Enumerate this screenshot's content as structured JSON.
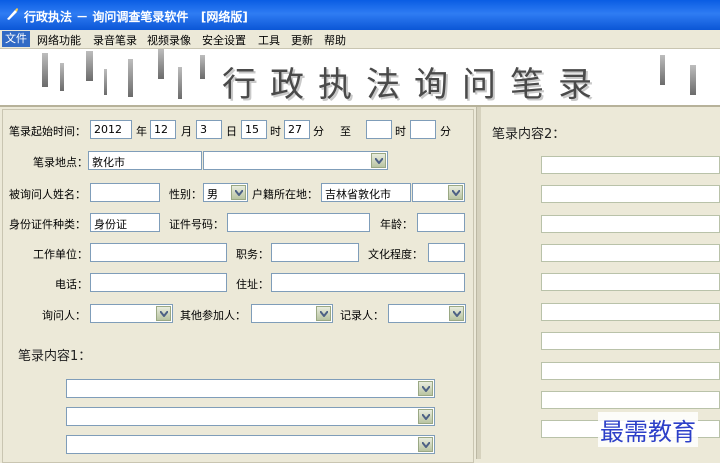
{
  "window": {
    "title": "行政执法 － 询问调查笔录软件   [网络版]"
  },
  "menu": [
    "文件",
    "网络功能",
    "录音笔录",
    "视频录像",
    "安全设置",
    "工具",
    "更新",
    "帮助"
  ],
  "banner": {
    "title": "行政执法询问笔录"
  },
  "form": {
    "start_time_label": "笔录起始时间：",
    "year": "2012",
    "year_unit": "年",
    "month": "12",
    "month_unit": "月",
    "day": "3",
    "day_unit": "日",
    "hour": "15",
    "hour_unit": "时",
    "minute": "27",
    "minute_unit": "分",
    "to": "至",
    "end_hour": "",
    "end_hour_unit": "时",
    "end_minute": "",
    "end_minute_unit": "分",
    "location_label": "笔录地点：",
    "location_value": "敦化市",
    "location_select": "",
    "name_label": "被询问人姓名：",
    "name_value": "",
    "gender_label": "性别：",
    "gender_value": "男",
    "hukou_label": "户籍所在地：",
    "hukou_value": "吉林省敦化市",
    "hukou_select": "",
    "id_type_label": "身份证件种类：",
    "id_type_value": "身份证",
    "id_no_label": "证件号码：",
    "id_no_value": "",
    "age_label": "年龄：",
    "age_value": "",
    "work_label": "工作单位：",
    "work_value": "",
    "position_label": "职务：",
    "position_value": "",
    "education_label": "文化程度：",
    "education_value": "",
    "phone_label": "电话：",
    "phone_value": "",
    "address_label": "住址：",
    "address_value": "",
    "inquirer_label": "询问人：",
    "inquirer_value": "",
    "others_label": "其他参加人：",
    "others_value": "",
    "recorder_label": "记录人：",
    "recorder_value": ""
  },
  "content1": {
    "label": "笔录内容1："
  },
  "content2": {
    "label": "笔录内容2："
  },
  "watermark": "最需教育",
  "colors": {
    "titlebar": "#0a5de3",
    "menu_active": "#316ac5",
    "window_bg": "#ece9d8",
    "watermark": "#2c3fc8"
  }
}
